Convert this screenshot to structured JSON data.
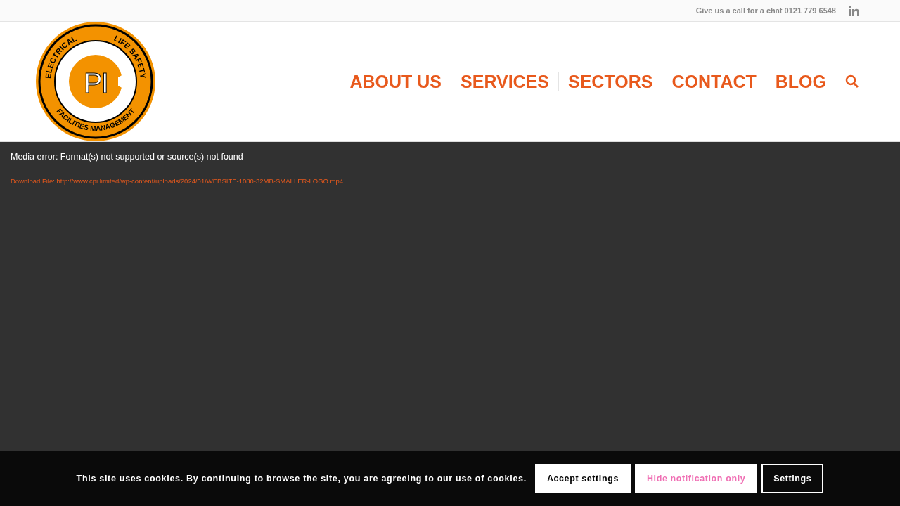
{
  "top_bar": {
    "phone_text": "Give us a call for a chat 0121 779 6548"
  },
  "logo": {
    "letters": "PI",
    "top_left": "ELECTRICAL",
    "top_right": "LIFE SAFETY",
    "bottom": "FACILITIES MANAGEMENT"
  },
  "nav": {
    "items": [
      {
        "label": "ABOUT US"
      },
      {
        "label": "SERVICES"
      },
      {
        "label": "SECTORS"
      },
      {
        "label": "CONTACT"
      },
      {
        "label": "BLOG"
      }
    ]
  },
  "media": {
    "error": "Media error: Format(s) not supported or source(s) not found",
    "download_link": "Download File: http://www.cpi.limited/wp-content/uploads/2024/01/WEBSITE-1080-32MB-SMALLER-LOGO.mp4"
  },
  "cookie_bar": {
    "message": "This site uses cookies. By continuing to browse the site, you are agreeing to our use of cookies.",
    "buttons": [
      {
        "label": "Accept settings",
        "kind": "solid"
      },
      {
        "label": "Hide notification only",
        "kind": "pink"
      },
      {
        "label": "Settings",
        "kind": "outline"
      }
    ]
  }
}
